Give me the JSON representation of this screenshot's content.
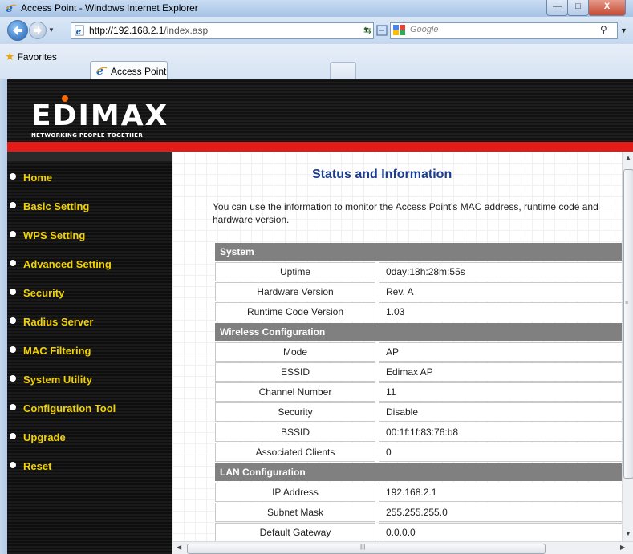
{
  "window": {
    "title": "Access Point - Windows Internet Explorer",
    "controls": {
      "minimize": "—",
      "maximize": "□",
      "close": "X"
    }
  },
  "address_bar": {
    "url_host": "http://192.168.2.1",
    "url_path": "/index.asp",
    "search_placeholder": "Google"
  },
  "favorites_bar": {
    "favorites_label": "Favorites",
    "tab_label": "Access Point"
  },
  "brand": {
    "logo_text": "EDIMAX",
    "tagline": "NETWORKING PEOPLE TOGETHER",
    "accent": "#e41b17",
    "nav_color": "#f2d200"
  },
  "sidebar": {
    "items": [
      {
        "label": "Home"
      },
      {
        "label": "Basic Setting"
      },
      {
        "label": "WPS Setting"
      },
      {
        "label": "Advanced Setting"
      },
      {
        "label": "Security"
      },
      {
        "label": "Radius Server"
      },
      {
        "label": "MAC Filtering"
      },
      {
        "label": "System Utility"
      },
      {
        "label": "Configuration Tool"
      },
      {
        "label": "Upgrade"
      },
      {
        "label": "Reset"
      }
    ]
  },
  "main": {
    "title": "Status and Information",
    "intro": "You can use the information to monitor the Access Point's MAC address, runtime code and hardware version.",
    "sections": [
      {
        "name": "System",
        "rows": [
          {
            "label": "Uptime",
            "value": "0day:18h:28m:55s"
          },
          {
            "label": "Hardware Version",
            "value": "Rev. A"
          },
          {
            "label": "Runtime Code Version",
            "value": "1.03"
          }
        ]
      },
      {
        "name": "Wireless Configuration",
        "rows": [
          {
            "label": "Mode",
            "value": "AP"
          },
          {
            "label": "ESSID",
            "value": "Edimax AP"
          },
          {
            "label": "Channel Number",
            "value": "11"
          },
          {
            "label": "Security",
            "value": "Disable"
          },
          {
            "label": "BSSID",
            "value": "00:1f:1f:83:76:b8"
          },
          {
            "label": "Associated Clients",
            "value": "0"
          }
        ]
      },
      {
        "name": "LAN Configuration",
        "rows": [
          {
            "label": "IP Address",
            "value": "192.168.2.1"
          },
          {
            "label": "Subnet Mask",
            "value": "255.255.255.0"
          },
          {
            "label": "Default Gateway",
            "value": "0.0.0.0"
          }
        ]
      }
    ]
  },
  "icons": [
    "ie-icon",
    "back-icon",
    "forward-icon",
    "page-icon",
    "refresh-icon",
    "stop-icon",
    "compat-icon",
    "google-icon",
    "search-icon",
    "star-icon",
    "bullet-icon"
  ]
}
